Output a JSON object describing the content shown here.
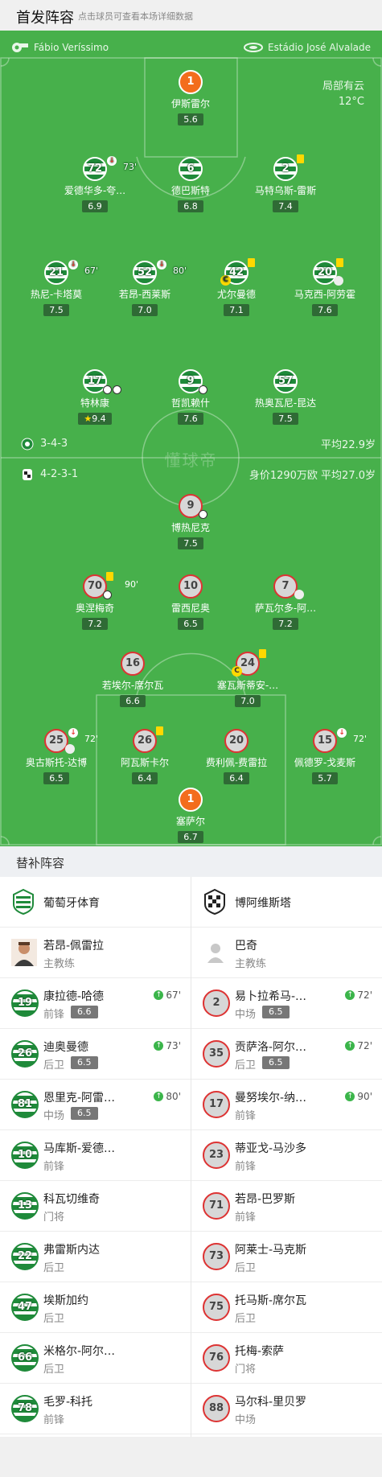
{
  "header": {
    "title": "首发阵容",
    "subtitle": "点击球员可查看本场详细数据"
  },
  "match": {
    "referee": "Fábio Veríssimo",
    "stadium": "Estádio José Alvalade",
    "weather": "局部有云",
    "temperature": "12°C",
    "watermark": "懂球帝"
  },
  "home": {
    "formation": "3-4-3",
    "avg_age": "平均22.9岁",
    "players": [
      {
        "num": "1",
        "name": "伊斯雷尔",
        "rating": "5.6"
      },
      {
        "num": "72",
        "name": "爱德华多-夸…",
        "rating": "6.9",
        "sub_time": "73'"
      },
      {
        "num": "6",
        "name": "德巴斯特",
        "rating": "6.8"
      },
      {
        "num": "2",
        "name": "马特乌斯-雷斯",
        "rating": "7.4"
      },
      {
        "num": "21",
        "name": "热尼-卡塔莫",
        "rating": "7.5",
        "sub_time": "67'"
      },
      {
        "num": "52",
        "name": "若昂-西莱斯",
        "rating": "7.0",
        "sub_time": "80'"
      },
      {
        "num": "42",
        "name": "尤尔曼德",
        "rating": "7.1"
      },
      {
        "num": "20",
        "name": "马克西-阿劳霍",
        "rating": "7.6"
      },
      {
        "num": "17",
        "name": "特林康",
        "rating": "9.4"
      },
      {
        "num": "9",
        "name": "哲凯赖什",
        "rating": "7.6"
      },
      {
        "num": "57",
        "name": "热奥瓦尼-昆达",
        "rating": "7.5"
      }
    ]
  },
  "away": {
    "formation": "4-2-3-1",
    "value_age": "身价1290万欧 平均27.0岁",
    "players": [
      {
        "num": "9",
        "name": "博热尼克",
        "rating": "7.5"
      },
      {
        "num": "70",
        "name": "奥涅梅奇",
        "rating": "7.2",
        "sub_time": "90'"
      },
      {
        "num": "10",
        "name": "雷西尼奥",
        "rating": "6.5"
      },
      {
        "num": "7",
        "name": "萨瓦尔多-阿…",
        "rating": "7.2"
      },
      {
        "num": "16",
        "name": "若埃尔-席尔瓦",
        "rating": "6.6"
      },
      {
        "num": "24",
        "name": "塞瓦斯蒂安-…",
        "rating": "7.0"
      },
      {
        "num": "25",
        "name": "奥古斯托-达博",
        "rating": "6.5",
        "sub_time": "72'"
      },
      {
        "num": "26",
        "name": "阿瓦斯卡尔",
        "rating": "6.4"
      },
      {
        "num": "20",
        "name": "费利佩-费雷拉",
        "rating": "6.4"
      },
      {
        "num": "15",
        "name": "佩德罗-戈麦斯",
        "rating": "5.7",
        "sub_time": "72'"
      },
      {
        "num": "1",
        "name": "塞萨尔",
        "rating": "6.7"
      }
    ]
  },
  "subs": {
    "title": "替补阵容",
    "home": {
      "team": "葡萄牙体育",
      "coach": {
        "name": "若昂-佩雷拉",
        "role": "主教练"
      },
      "players": [
        {
          "num": "19",
          "name": "康拉德-哈德",
          "pos": "前锋",
          "rating": "6.6",
          "time": "67'"
        },
        {
          "num": "26",
          "name": "迪奥曼德",
          "pos": "后卫",
          "rating": "6.5",
          "time": "73'"
        },
        {
          "num": "81",
          "name": "恩里克-阿雷…",
          "pos": "中场",
          "rating": "6.5",
          "time": "80'"
        },
        {
          "num": "10",
          "name": "马库斯-爱德…",
          "pos": "前锋"
        },
        {
          "num": "13",
          "name": "科瓦切维奇",
          "pos": "门将"
        },
        {
          "num": "22",
          "name": "弗雷斯内达",
          "pos": "后卫"
        },
        {
          "num": "47",
          "name": "埃斯加约",
          "pos": "后卫"
        },
        {
          "num": "66",
          "name": "米格尔-阿尔…",
          "pos": "后卫"
        },
        {
          "num": "78",
          "name": "毛罗-科托",
          "pos": "前锋"
        }
      ]
    },
    "away": {
      "team": "博阿维斯塔",
      "coach": {
        "name": "巴奇",
        "role": "主教练"
      },
      "players": [
        {
          "num": "2",
          "name": "易卜拉希马-…",
          "pos": "中场",
          "rating": "6.5",
          "time": "72'"
        },
        {
          "num": "35",
          "name": "贡萨洛-阿尔…",
          "pos": "后卫",
          "rating": "6.5",
          "time": "72'"
        },
        {
          "num": "17",
          "name": "曼努埃尔-纳…",
          "pos": "前锋",
          "time": "90'"
        },
        {
          "num": "23",
          "name": "蒂亚戈-马沙多",
          "pos": "前锋"
        },
        {
          "num": "71",
          "name": "若昂-巴罗斯",
          "pos": "前锋"
        },
        {
          "num": "73",
          "name": "阿莱士-马克斯",
          "pos": "后卫"
        },
        {
          "num": "75",
          "name": "托马斯-席尔瓦",
          "pos": "后卫"
        },
        {
          "num": "76",
          "name": "托梅-索萨",
          "pos": "门将"
        },
        {
          "num": "88",
          "name": "马尔科-里贝罗",
          "pos": "中场"
        }
      ]
    }
  },
  "colors": {
    "pitch": "#47b04b",
    "home_green": "#1f8a3a",
    "gk_orange": "#f36d1d",
    "away_red": "#d33",
    "card_yellow": "#ffd800"
  }
}
